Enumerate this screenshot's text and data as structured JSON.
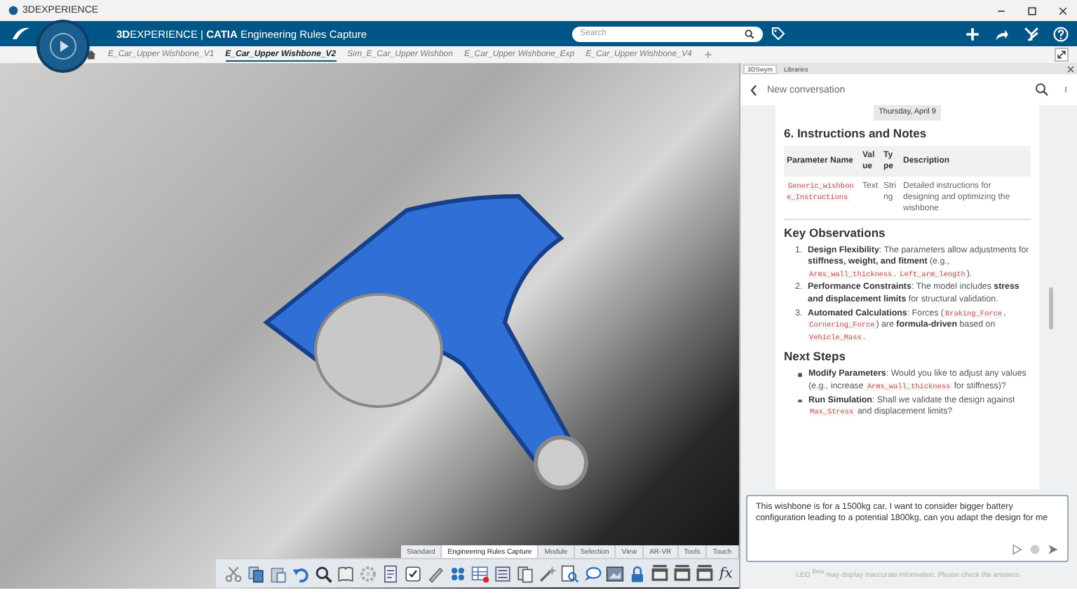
{
  "window": {
    "title": "3DEXPERIENCE"
  },
  "top_bar": {
    "title": "**3D**EXPERIENCE | **CATIA** Engineering Rules Capture",
    "search": {
      "placeholder": "Search"
    }
  },
  "doc_tabs": [
    {
      "label": "E_Car_Upper Wishbone_V1",
      "selected": false
    },
    {
      "label": "E_Car_Upper Wishbone_V2",
      "selected": true
    },
    {
      "label": "Sim_E_Car_Upper Wishbon",
      "selected": false
    },
    {
      "label": "E_Car_Upper Wishbone_Exp",
      "selected": false
    },
    {
      "label": "E_Car_Upper Wishbone_V4",
      "selected": false
    }
  ],
  "toolbar": {
    "tabs": [
      {
        "label": "Standard",
        "selected": false
      },
      {
        "label": "Engineering Rules Capture",
        "selected": true
      },
      {
        "label": "Module",
        "selected": false
      },
      {
        "label": "Selection",
        "selected": false
      },
      {
        "label": "View",
        "selected": false
      },
      {
        "label": "AR-VR",
        "selected": false
      },
      {
        "label": "Tools",
        "selected": false
      },
      {
        "label": "Touch",
        "selected": false
      }
    ],
    "formula_button": "fx"
  },
  "chat_panel": {
    "tabs": [
      {
        "label": "3DSwym",
        "selected": true
      },
      {
        "label": "Libraries",
        "selected": false
      }
    ],
    "header": "New conversation",
    "date": "Thursday, April 9",
    "section_title": "6. Instructions and Notes",
    "table": {
      "columns": [
        "Parameter Name",
        "Value",
        "Type",
        "Description"
      ],
      "rows": [
        [
          "Generic_wishbone_Instructions",
          "Text",
          "String",
          "Detailed instructions for designing and optimizing the wishbone"
        ]
      ]
    },
    "lists": [
      {
        "title": "Key Observations",
        "kind": "ordered",
        "items": [
          {
            "marker": "1.",
            "parts": [
              {
                "kind": "text",
                "text": "**Design Flexibility**: The parameters allow adjustments for **stiffness, weight, and fitment** (e.g., "
              },
              {
                "kind": "code",
                "text": "Arms_wall_thickness"
              },
              {
                "kind": "text",
                "text": ", "
              },
              {
                "kind": "code",
                "text": "Left_arm_length"
              },
              {
                "kind": "text",
                "text": ")."
              }
            ]
          },
          {
            "marker": "2.",
            "parts": [
              {
                "kind": "text",
                "text": "**Performance Constraints**: The model includes **stress and displacement limits** for structural validation."
              }
            ]
          },
          {
            "marker": "3.",
            "parts": [
              {
                "kind": "text",
                "text": "**Automated Calculations**: Forces ("
              },
              {
                "kind": "code",
                "text": "Braking_Force"
              },
              {
                "kind": "text",
                "text": ", "
              },
              {
                "kind": "code",
                "text": "Cornering_Force"
              },
              {
                "kind": "text",
                "text": ") are **formula-driven** based on "
              },
              {
                "kind": "code",
                "text": "Vehicle_Mass"
              },
              {
                "kind": "text",
                "text": "."
              }
            ]
          }
        ]
      },
      {
        "title": "Next Steps",
        "kind": "bulleted",
        "items": [
          {
            "parts": [
              {
                "kind": "text",
                "text": "**Modify Parameters**: Would you like to adjust any values (e.g., increase "
              },
              {
                "kind": "code",
                "text": "Arms_wall_thickness"
              },
              {
                "kind": "text",
                "text": " for stiffness)?"
              }
            ]
          },
          {
            "parts": [
              {
                "kind": "text",
                "text": "**Run Simulation**: Shall we validate the design against "
              },
              {
                "kind": "code",
                "text": "Max_Stress"
              },
              {
                "kind": "text",
                "text": " and displacement limits?"
              }
            ]
          }
        ]
      }
    ],
    "input": {
      "value": "This wishbone is for a 1500kg car, I want to consider bigger battery configuration leading to a potential 1800kg, can you adapt the design for me"
    },
    "disclaimer": "LEO $^{Beta}$ may display inaccurate information. Please check the answers."
  }
}
